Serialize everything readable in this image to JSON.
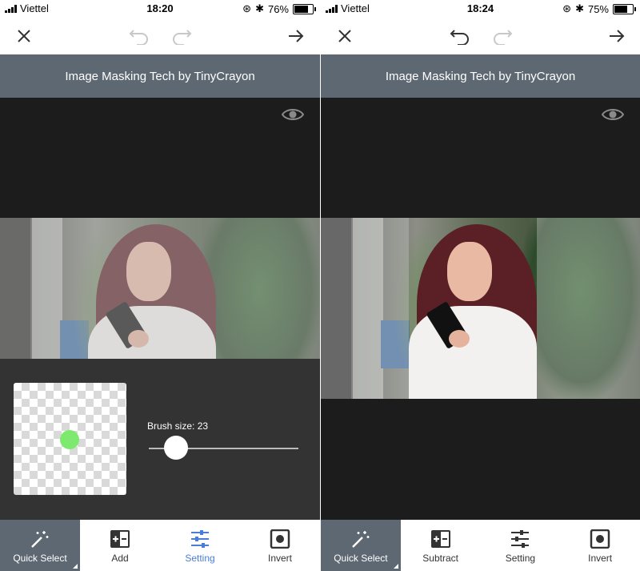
{
  "colors": {
    "header_bg": "#5e6873",
    "accent_blue": "#4a7ed6",
    "canvas_bg": "#1c1c1c",
    "settings_bg": "#333333",
    "brush_green": "#7dea6f"
  },
  "left": {
    "status": {
      "carrier": "Viettel",
      "time": "18:20",
      "battery": "76%",
      "battery_level": 0.76
    },
    "toolbar": {
      "close_icon": "close-icon",
      "undo_enabled": false,
      "redo_enabled": false,
      "next_icon": "arrow-right-icon"
    },
    "banner": "Image Masking Tech by TinyCrayon",
    "settings": {
      "brush_label": "Brush size: 23",
      "brush_value": 23
    },
    "tabs": [
      {
        "label": "Quick Select",
        "icon": "magic-wand-icon"
      },
      {
        "label": "Add",
        "icon": "add-mask-icon"
      },
      {
        "label": "Setting",
        "icon": "sliders-icon"
      },
      {
        "label": "Invert",
        "icon": "invert-icon"
      }
    ]
  },
  "right": {
    "status": {
      "carrier": "Viettel",
      "time": "18:24",
      "battery": "75%",
      "battery_level": 0.75
    },
    "toolbar": {
      "close_icon": "close-icon",
      "undo_enabled": true,
      "redo_enabled": false,
      "next_icon": "arrow-right-icon"
    },
    "banner": "Image Masking Tech by TinyCrayon",
    "tabs": [
      {
        "label": "Quick Select",
        "icon": "magic-wand-icon"
      },
      {
        "label": "Subtract",
        "icon": "subtract-mask-icon"
      },
      {
        "label": "Setting",
        "icon": "sliders-icon"
      },
      {
        "label": "Invert",
        "icon": "invert-icon"
      }
    ]
  }
}
